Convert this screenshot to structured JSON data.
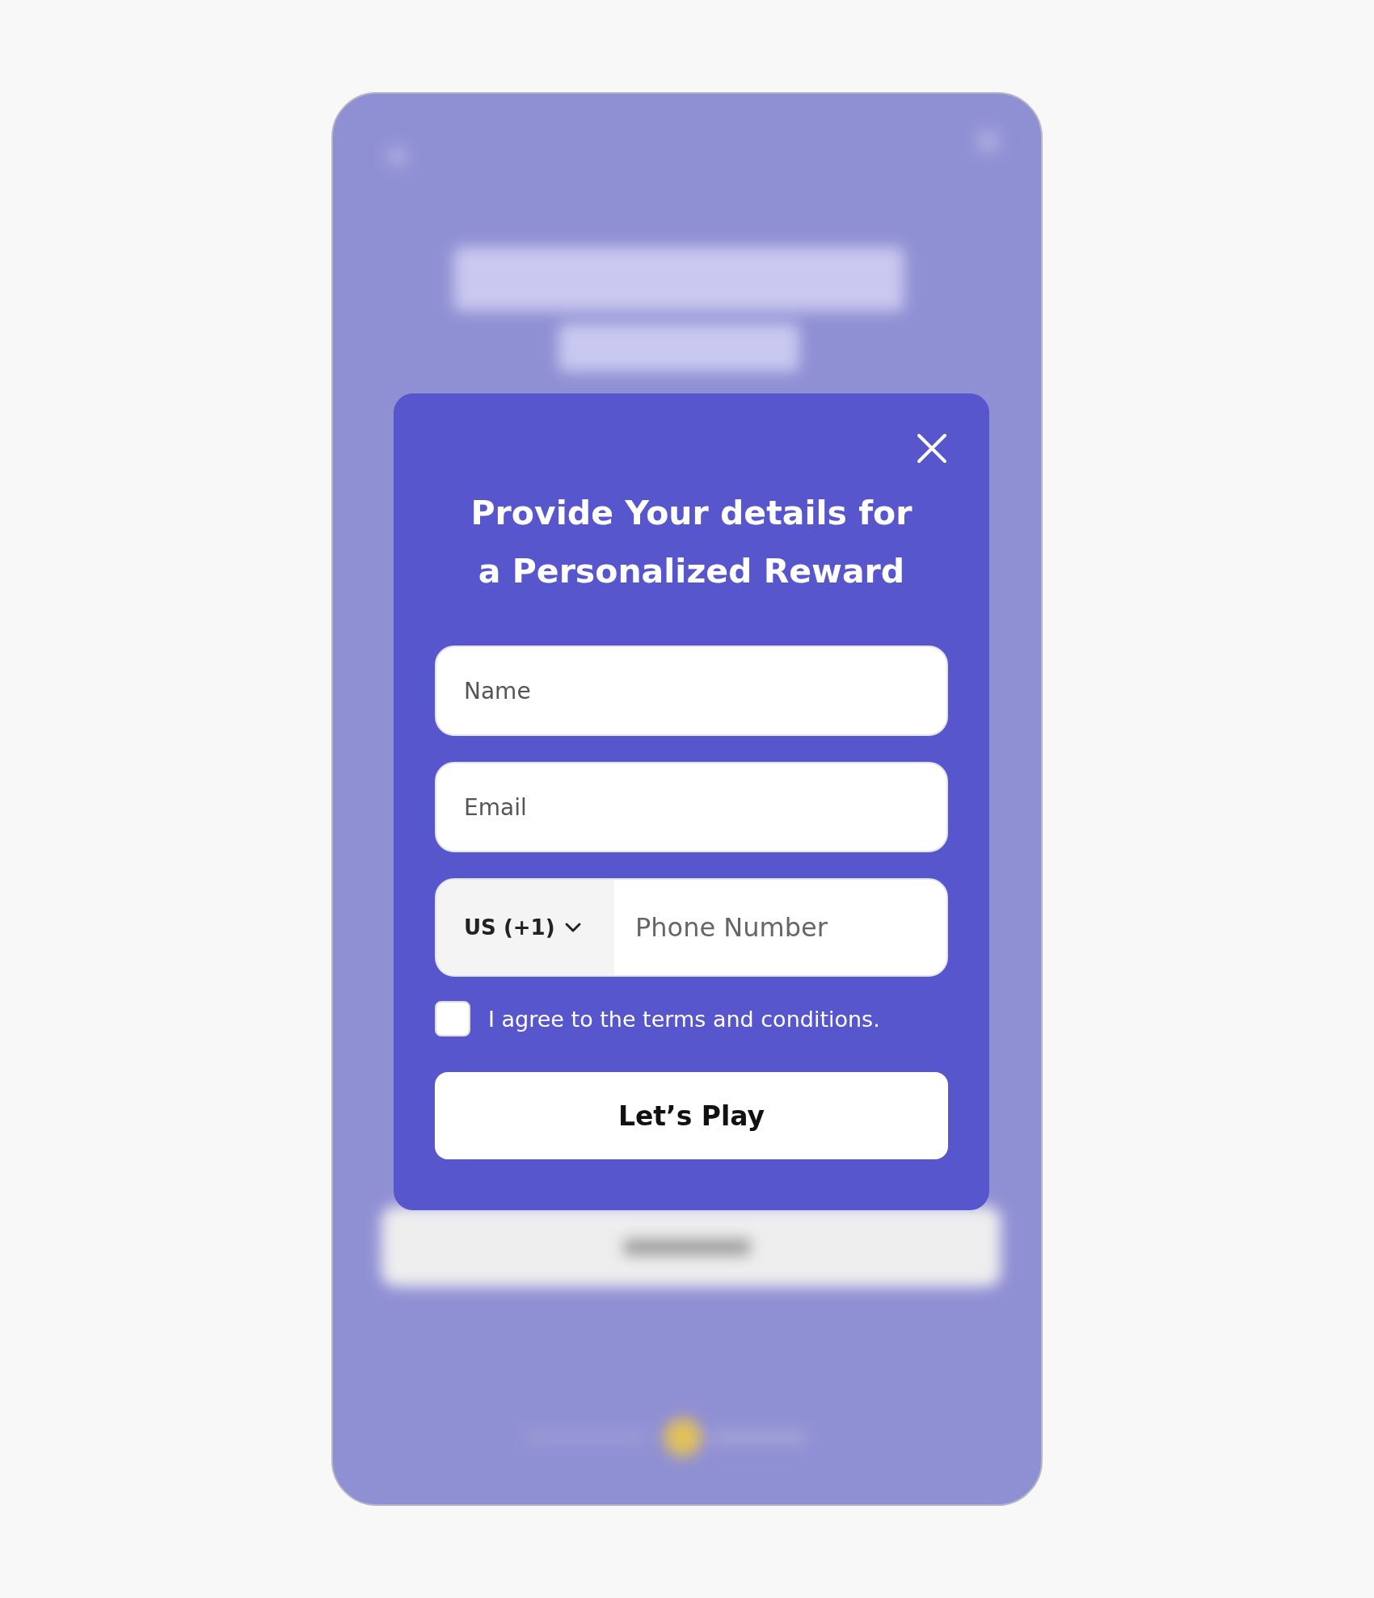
{
  "modal": {
    "title": "Provide Your details for a Personalized Reward",
    "fields": [
      {
        "kind": "text",
        "placeholder": "Name"
      },
      {
        "kind": "text",
        "placeholder": "Email"
      },
      {
        "kind": "phone",
        "country": "US (+1)",
        "placeholder": "Phone Number"
      }
    ],
    "consent": {
      "label": "I agree to the terms and conditions.",
      "checked": false
    },
    "submit": "Let’s Play"
  }
}
